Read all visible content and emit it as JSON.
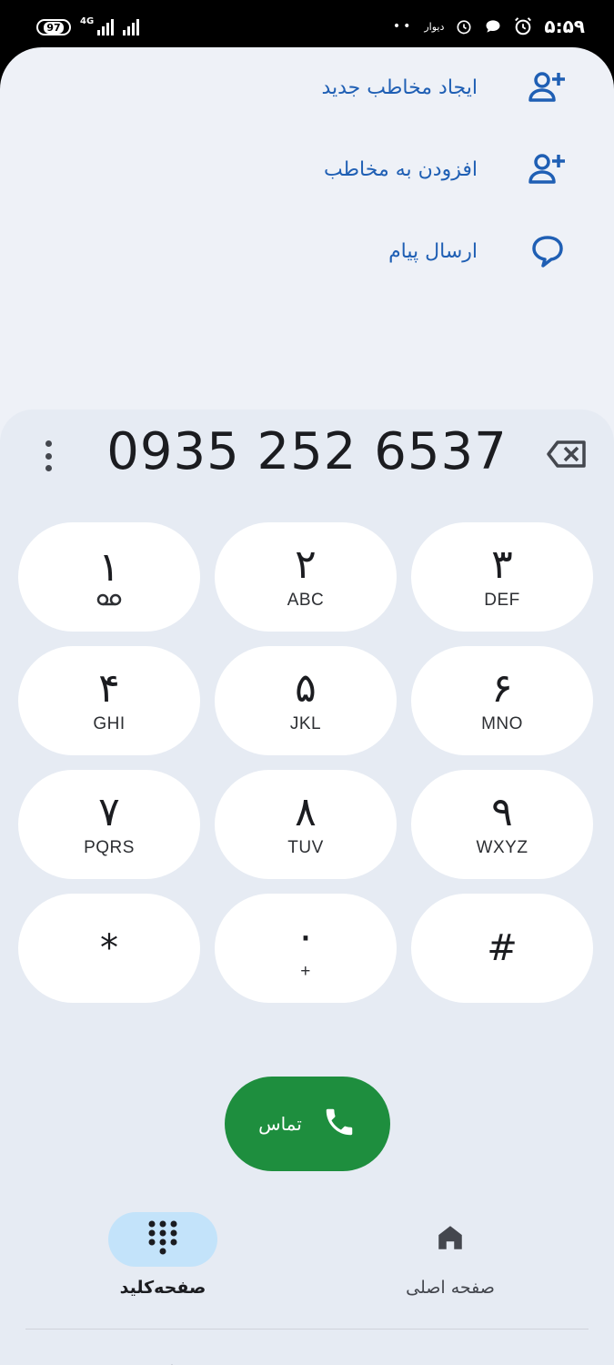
{
  "status": {
    "battery": "97",
    "network": "4G",
    "carrier_text": "دیوار",
    "dots": "••",
    "time": "۵:۵۹"
  },
  "actions": [
    {
      "label": "ایجاد مخاطب جدید",
      "icon": "person-add-icon"
    },
    {
      "label": "افزودن به مخاطب",
      "icon": "person-add-icon"
    },
    {
      "label": "ارسال پیام",
      "icon": "message-icon"
    }
  ],
  "dialer": {
    "number": "0935 252 6537",
    "keys": [
      {
        "digit": "۱",
        "letters": ""
      },
      {
        "digit": "۲",
        "letters": "ABC"
      },
      {
        "digit": "۳",
        "letters": "DEF"
      },
      {
        "digit": "۴",
        "letters": "GHI"
      },
      {
        "digit": "۵",
        "letters": "JKL"
      },
      {
        "digit": "۶",
        "letters": "MNO"
      },
      {
        "digit": "۷",
        "letters": "PQRS"
      },
      {
        "digit": "۸",
        "letters": "TUV"
      },
      {
        "digit": "۹",
        "letters": "WXYZ"
      },
      {
        "digit": "*",
        "letters": ""
      },
      {
        "digit": "۰",
        "letters": "+"
      },
      {
        "digit": "#",
        "letters": ""
      }
    ],
    "call_label": "تماس"
  },
  "bottom_nav": {
    "keypad_label": "صفحه‌کلید",
    "home_label": "صفحه اصلی"
  },
  "colors": {
    "accent_blue": "#1f5fb4",
    "call_green": "#1e8e3e",
    "active_pill": "#c3e3fa",
    "panel": "#e6ebf3"
  }
}
